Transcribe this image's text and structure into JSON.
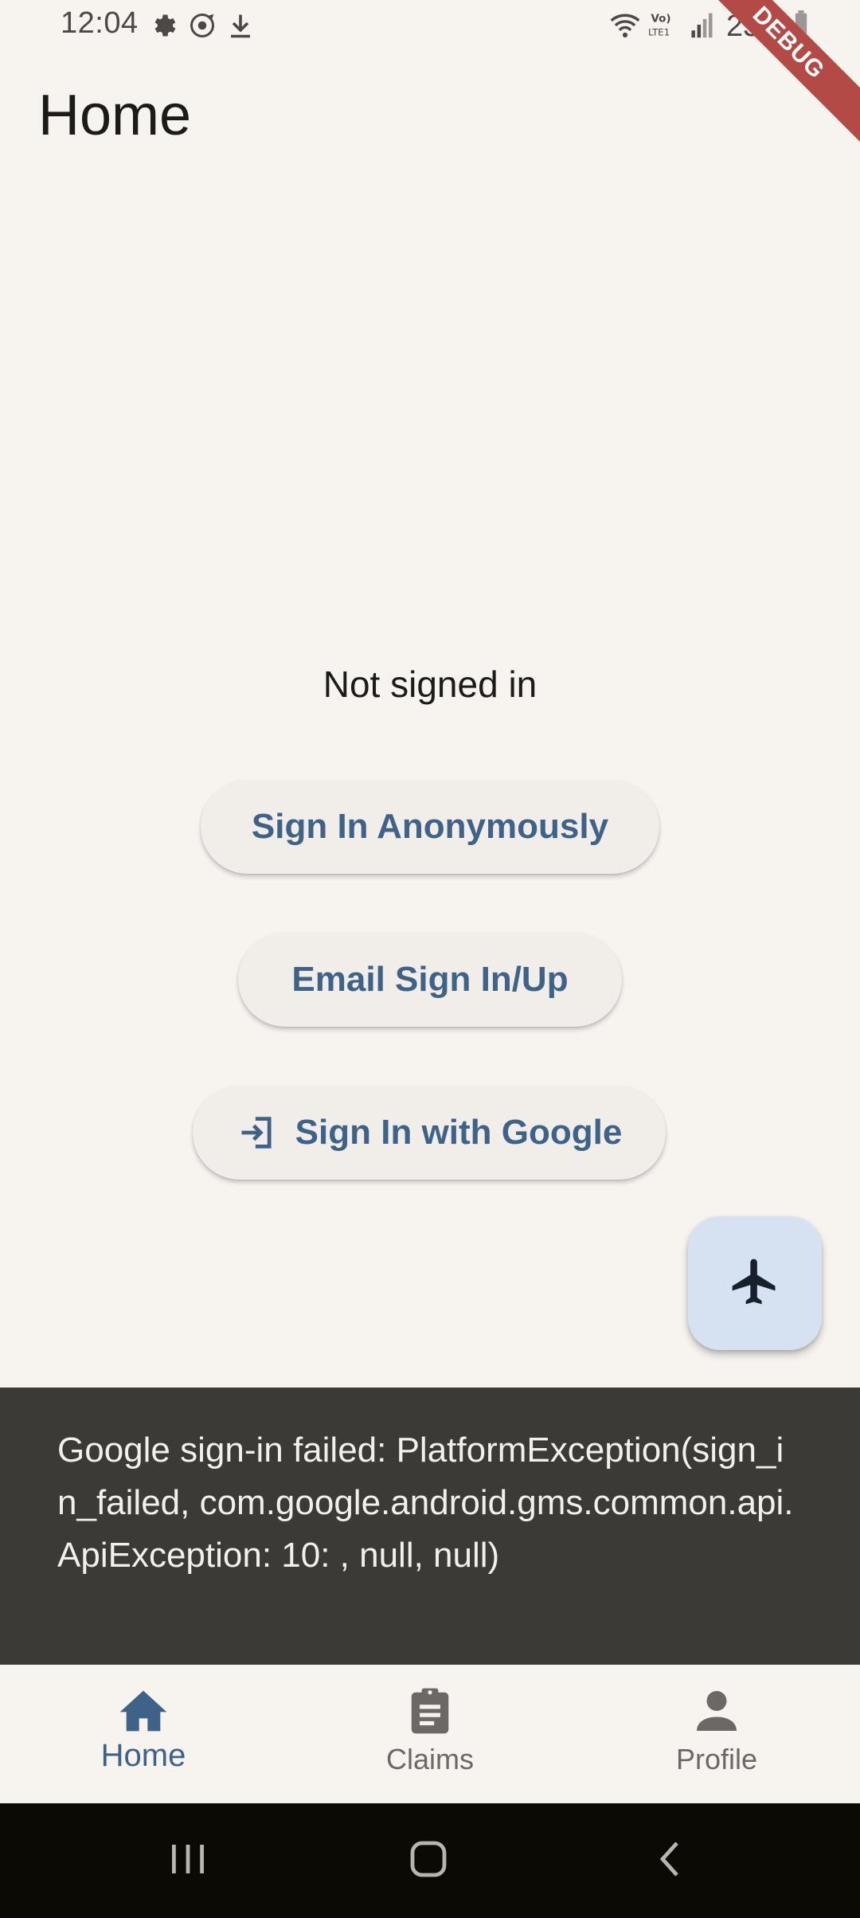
{
  "status_bar": {
    "time": "12:04",
    "battery": "23%",
    "left_icons": [
      "settings-icon",
      "sync-icon",
      "download-icon"
    ],
    "right_icons": [
      "wifi-icon",
      "volte-icon",
      "signal-icon",
      "battery-icon"
    ]
  },
  "debug_banner": "DEBUG",
  "app_bar": {
    "title": "Home"
  },
  "main": {
    "status_text": "Not signed in",
    "buttons": {
      "anonymous": "Sign In Anonymously",
      "email": "Email Sign In/Up",
      "google": "Sign In with Google"
    },
    "google_button_icon": "login-icon",
    "fab_icon": "airplane-icon"
  },
  "snackbar": {
    "message": "Google sign-in failed: PlatformException(sign_in_failed, com.google.android.gms.common.api.ApiException: 10: , null, null)"
  },
  "bottom_nav": {
    "items": [
      {
        "label": "Home",
        "icon": "home-icon",
        "active": true
      },
      {
        "label": "Claims",
        "icon": "clipboard-icon",
        "active": false
      },
      {
        "label": "Profile",
        "icon": "person-icon",
        "active": false
      }
    ]
  },
  "system_nav": {
    "buttons": [
      "recents-icon",
      "home-icon",
      "back-icon"
    ]
  },
  "colors": {
    "background": "#f7f4f0",
    "accent": "#3f6388",
    "button_bg": "#f1eeea",
    "fab_bg": "#d6e2f1",
    "snackbar_bg": "#3b3a37",
    "debug_banner": "#b34a45",
    "system_nav_bg": "#0c0a05"
  }
}
